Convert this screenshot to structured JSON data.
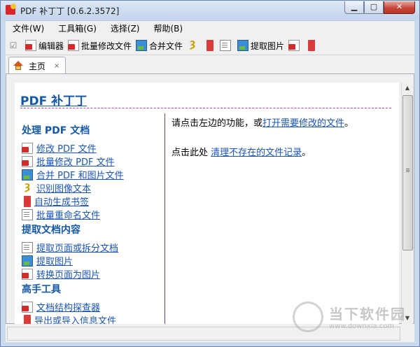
{
  "window": {
    "title": "PDF 补丁丁 [0.6.2.3572]"
  },
  "menubar": {
    "items": [
      "文件(W)",
      "工具箱(G)",
      "选择(Z)",
      "帮助(B)"
    ]
  },
  "toolbar": {
    "editor_label": "编辑器",
    "batch_edit_label": "批量修改文件",
    "merge_label": "合并文件",
    "extract_images_label": "提取图片"
  },
  "tabs": [
    {
      "label": "主页",
      "close": "×"
    }
  ],
  "page": {
    "title": "PDF 补丁丁",
    "sections": [
      {
        "heading": "处理 PDF 文档",
        "items": [
          "修改 PDF 文件",
          "批量修改 PDF 文件",
          "合并 PDF 和图片文件",
          "识别图像文本",
          "自动生成书签",
          "批量重命名文件"
        ]
      },
      {
        "heading": "提取文档内容",
        "items": [
          "提取页面或拆分文档",
          "提取图片",
          "转换页面为图片"
        ]
      },
      {
        "heading": "高手工具",
        "items": [
          "文档结构探查器",
          "导出或导入信息文件"
        ]
      }
    ],
    "right": {
      "line1_prefix": "请点击左边的功能，或",
      "line1_link": "打开需要修改的文件",
      "line1_suffix": "。",
      "line2_prefix": "点击此处 ",
      "line2_link": "清理不存在的文件记录",
      "line2_suffix": "。"
    }
  },
  "watermark": {
    "name": "当下软件园",
    "url": "www.downxia.com"
  }
}
